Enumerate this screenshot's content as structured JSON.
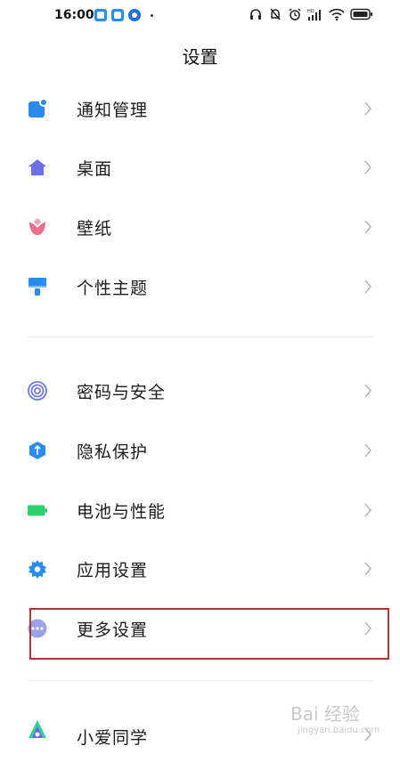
{
  "status_bar": {
    "time": "16:00",
    "app_icons": [
      "app-square-icon",
      "app-square-icon",
      "app-c-icon"
    ],
    "right_icons": [
      "headset-icon",
      "mute-bell-icon",
      "alarm-icon",
      "signal-icon",
      "wifi-icon",
      "battery-icon"
    ]
  },
  "header": {
    "title": "设置"
  },
  "settings": {
    "group1": [
      {
        "label": "通知管理",
        "icon": "notification-icon"
      },
      {
        "label": "桌面",
        "icon": "home-icon"
      },
      {
        "label": "壁纸",
        "icon": "tulip-icon"
      },
      {
        "label": "个性主题",
        "icon": "brush-icon"
      }
    ],
    "group2": [
      {
        "label": "密码与安全",
        "icon": "fingerprint-icon"
      },
      {
        "label": "隐私保护",
        "icon": "privacy-shield-icon"
      },
      {
        "label": "电池与性能",
        "icon": "battery-icon"
      },
      {
        "label": "应用设置",
        "icon": "gear-icon"
      },
      {
        "label": "更多设置",
        "icon": "more-icon"
      }
    ],
    "group3": [
      {
        "label": "小爱同学",
        "icon": "xiaoai-icon"
      }
    ]
  },
  "watermark": {
    "main": "Bai 经验",
    "sub": "jingyan.baidu.com"
  },
  "colors": {
    "notification": "#2a8cf0",
    "home": "#6b6ee6",
    "tulip": "#e8708a",
    "brush": "#2a8cf0",
    "fingerprint": "#6f7ad8",
    "privacy": "#2a8cf0",
    "battery": "#2ccf6a",
    "gear": "#2a8cf0",
    "more": "#9aa3e8",
    "highlight": "#a33a3a"
  }
}
